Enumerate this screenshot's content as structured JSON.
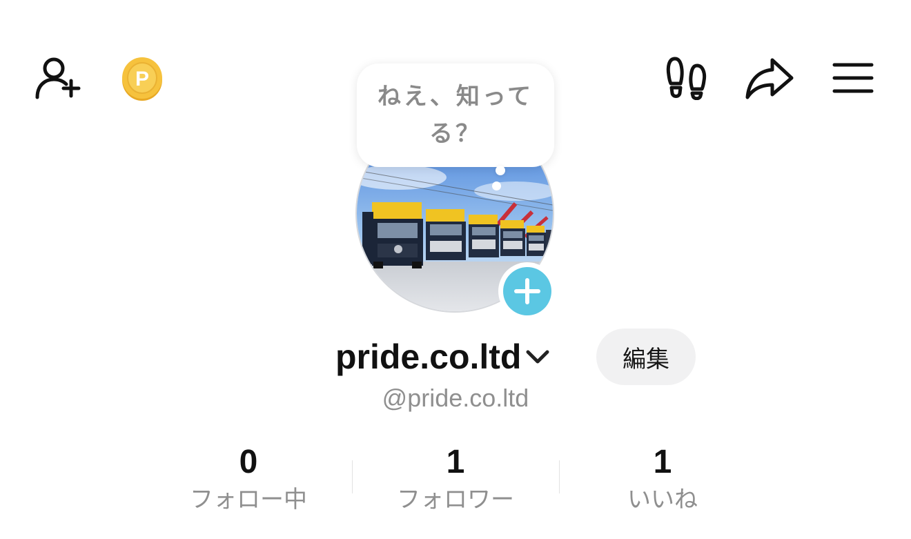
{
  "header": {
    "left_icons": [
      "add-friend-icon",
      "coin-icon"
    ],
    "right_icons": [
      "footprints-icon",
      "share-icon",
      "menu-icon"
    ],
    "coin_letter": "P"
  },
  "bubble": {
    "text": "ねえ、知ってる？"
  },
  "profile": {
    "name": "pride.co.ltd",
    "handle": "@pride.co.ltd",
    "edit_label": "編集"
  },
  "stats": [
    {
      "value": "0",
      "label": "フォロー中"
    },
    {
      "value": "1",
      "label": "フォロワー"
    },
    {
      "value": "1",
      "label": "いいね"
    }
  ],
  "colors": {
    "accent": "#5bc7e3",
    "coin": "#f6c23d",
    "text": "#111111",
    "muted": "#8f8f8f",
    "button_bg": "#f1f1f2"
  }
}
